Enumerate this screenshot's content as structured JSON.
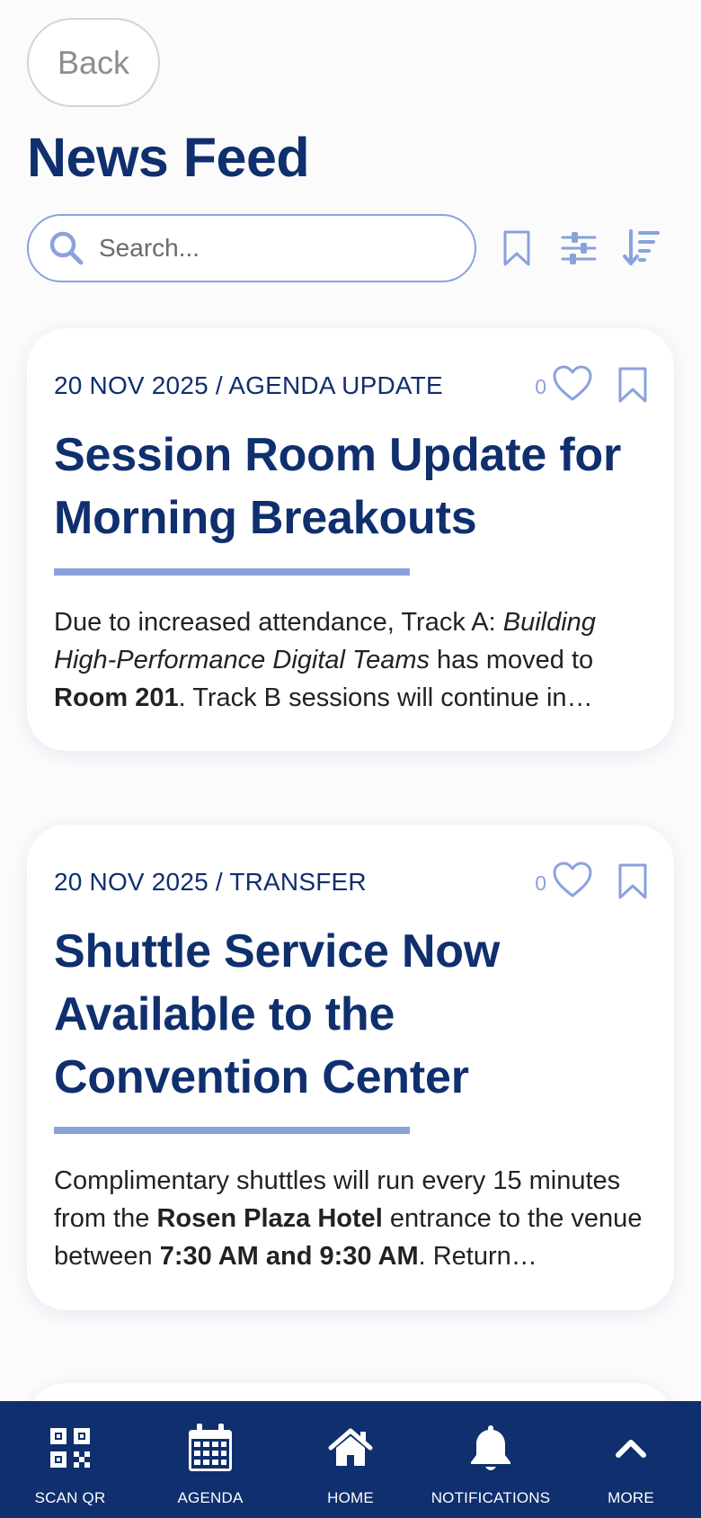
{
  "header": {
    "back_label": "Back",
    "title": "News Feed"
  },
  "search": {
    "placeholder": "Search..."
  },
  "toolbar": {
    "icons": [
      "bookmark-icon",
      "filter-sliders-icon",
      "sort-icon"
    ]
  },
  "colors": {
    "primary": "#0f2f6e",
    "accent": "#8aa2dc",
    "background": "#fbfbfc"
  },
  "posts": [
    {
      "date": "20 NOV 2025",
      "separator": " / ",
      "category": "AGENDA UPDATE",
      "likes": "0",
      "title": "Session Room Update for Morning Breakouts",
      "body": {
        "t1": "Due to increased attendance, Track A: ",
        "t2": "Building High-Performance Digital Teams",
        "t3": " has moved to ",
        "t4": "Room 201",
        "t5": ". Track B sessions will continue in…"
      }
    },
    {
      "date": "20 NOV 2025",
      "separator": " / ",
      "category": "TRANSFER",
      "likes": "0",
      "title": "Shuttle Service Now Available to the Convention Center",
      "body": {
        "t1": "Complimentary shuttles will run every 15 minutes from the ",
        "t2": "Rosen Plaza Hotel",
        "t3": " entrance to the venue between ",
        "t4": "7:30 AM and 9:30 AM",
        "t5": ". Return…"
      }
    }
  ],
  "nav": [
    {
      "label": "SCAN QR",
      "icon": "qr-code-icon"
    },
    {
      "label": "AGENDA",
      "icon": "calendar-icon"
    },
    {
      "label": "HOME",
      "icon": "home-icon"
    },
    {
      "label": "NOTIFICATIONS",
      "icon": "bell-icon"
    },
    {
      "label": "MORE",
      "icon": "chevron-up-icon"
    }
  ]
}
